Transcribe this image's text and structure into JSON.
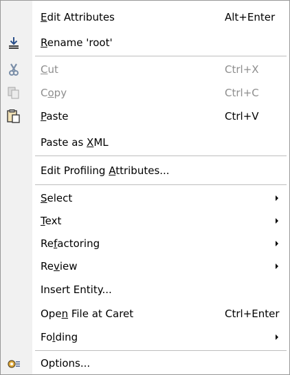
{
  "menu": {
    "items": [
      {
        "name": "edit-attributes",
        "pre": "",
        "key": "E",
        "post": "dit Attributes",
        "shortcut": "Alt+Enter"
      },
      {
        "name": "rename-root",
        "pre": "",
        "key": "R",
        "post": "ename 'root'",
        "shortcut": ""
      },
      {
        "name": "cut",
        "pre": "",
        "key": "C",
        "post": "ut",
        "shortcut": "Ctrl+X"
      },
      {
        "name": "copy",
        "pre": "C",
        "key": "o",
        "post": "py",
        "shortcut": "Ctrl+C"
      },
      {
        "name": "paste",
        "pre": "",
        "key": "P",
        "post": "aste",
        "shortcut": "Ctrl+V"
      },
      {
        "name": "paste-as-xml",
        "pre": "Paste as ",
        "key": "X",
        "post": "ML",
        "shortcut": ""
      },
      {
        "name": "edit-profiling-attributes",
        "pre": "Edit Profiling ",
        "key": "A",
        "post": "ttributes...",
        "shortcut": ""
      },
      {
        "name": "select",
        "pre": "",
        "key": "S",
        "post": "elect",
        "shortcut": ""
      },
      {
        "name": "text",
        "pre": "",
        "key": "T",
        "post": "ext",
        "shortcut": ""
      },
      {
        "name": "refactoring",
        "pre": "Re",
        "key": "f",
        "post": "actoring",
        "shortcut": ""
      },
      {
        "name": "review",
        "pre": "Re",
        "key": "v",
        "post": "iew",
        "shortcut": ""
      },
      {
        "name": "insert-entity",
        "pre": "Insert Entity...",
        "key": "",
        "post": "",
        "shortcut": ""
      },
      {
        "name": "open-file-at-caret",
        "pre": "Ope",
        "key": "n",
        "post": " File at Caret",
        "shortcut": "Ctrl+Enter"
      },
      {
        "name": "folding",
        "pre": "Fo",
        "key": "l",
        "post": "ding",
        "shortcut": ""
      },
      {
        "name": "options",
        "pre": "Options...",
        "key": "",
        "post": "",
        "shortcut": ""
      }
    ],
    "disabled": [
      "cut",
      "copy"
    ],
    "submenus": [
      "select",
      "text",
      "refactoring",
      "review",
      "folding"
    ],
    "icons": {
      "rename-root": "download-arrow-icon",
      "cut": "scissors-icon",
      "copy": "copy-pages-icon",
      "paste": "clipboard-paste-icon",
      "options": "gear-options-icon"
    },
    "colors": {
      "icon_gutter": "#f1f1f1",
      "disabled_text": "#8d8d8d",
      "separator": "#bdbdbd",
      "border": "#979797"
    }
  }
}
